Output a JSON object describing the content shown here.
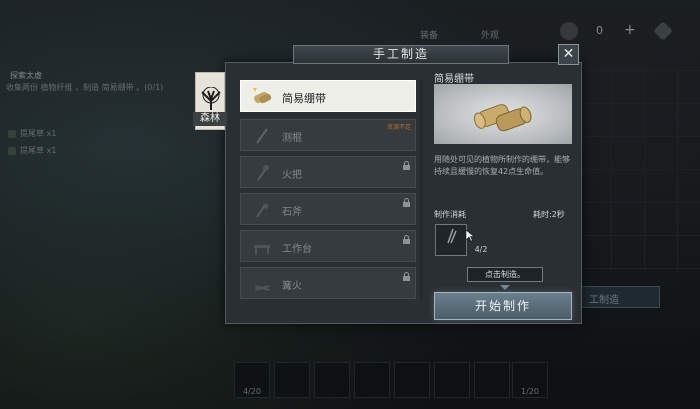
{
  "panel": {
    "title": "手工制造",
    "close_label": "✕"
  },
  "biome": {
    "label": "森林"
  },
  "recipes": [
    {
      "label": "简易绷带",
      "icon": "bandage-icon",
      "selected": true
    },
    {
      "label": "测棍",
      "icon": "stick-icon",
      "tag": "资源不足"
    },
    {
      "label": "火把",
      "icon": "torch-icon",
      "locked": true
    },
    {
      "label": "石斧",
      "icon": "axe-icon",
      "locked": true
    },
    {
      "label": "工作台",
      "icon": "workbench-icon",
      "locked": true
    },
    {
      "label": "篝火",
      "icon": "campfire-icon",
      "locked": true
    }
  ],
  "detail": {
    "name": "简易绷带",
    "description": "用随处可见的植物所制作的绷带，能够持续且缓慢的恢复42点生命值。",
    "cost_label": "制作消耗",
    "time_label": "耗时:2秒",
    "material_count": "4/2",
    "tooltip": "点击制造。",
    "start_label": "开始制作"
  },
  "background": {
    "quest_title": "探索太虚",
    "quest_line": "收集两份 植物纤维 ，制造 简易绷带 。(0/1)",
    "quest_highlight": "植物纤维",
    "resource_rows": [
      "提尾草 x1",
      "提尾草 x1"
    ],
    "tabs": [
      "装备",
      "外观"
    ],
    "currency": "0",
    "plus": "+",
    "craft_button": "工制造",
    "hotbar_counts": [
      "4/20",
      "1/20"
    ]
  }
}
